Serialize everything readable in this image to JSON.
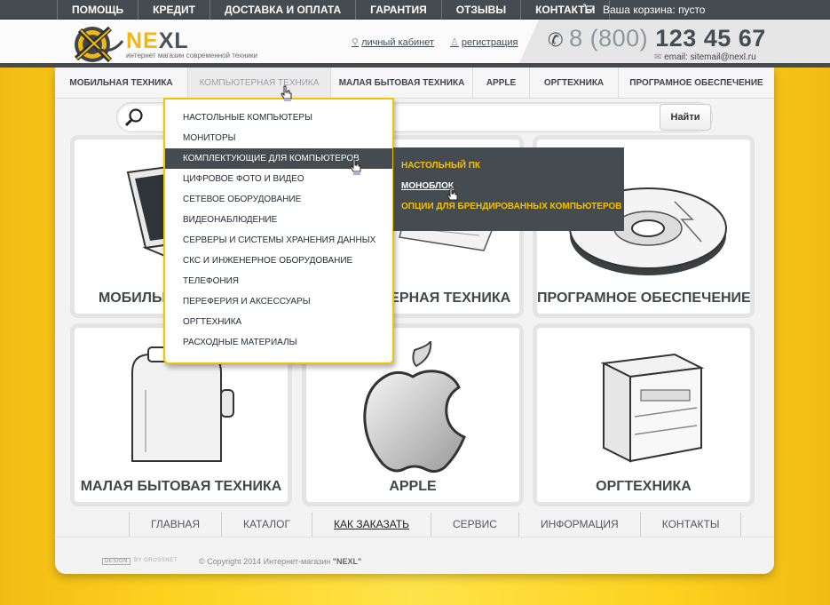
{
  "topbar": {
    "links": [
      "ПОМОЩЬ",
      "КРЕДИТ",
      "ДОСТАВКА И ОПЛАТА",
      "ГАРАНТИЯ",
      "ОТЗЫВЫ",
      "КОНТАКТЫ"
    ],
    "cart_text": "Ваша корзина: пусто",
    "cart_icon": "cart-icon"
  },
  "header": {
    "brand_ne": "NE",
    "brand_xl": "XL",
    "tagline": "интернет магазин современной техники",
    "account_link": "личный кабинет",
    "register_link": "регистрация",
    "phone_prefix": "8 (800)",
    "phone_number": "123 45 67",
    "email": "email: sitemail@nexl.ru"
  },
  "mainnav": {
    "items": [
      "МОБИЛЬНАЯ ТЕХНИКА",
      "КОМПЬЮТЕРНАЯ ТЕХНИКА",
      "МАЛАЯ БЫТОВАЯ ТЕХНИКА",
      "APPLE",
      "ОРГТЕХНИКА",
      "ПРОГРАМНОЕ ОБЕСПЕЧЕНИЕ"
    ],
    "active": "КОМПЬЮТЕРНАЯ ТЕХНИКА"
  },
  "search": {
    "placeholder": "",
    "button": "Найти"
  },
  "dropdown": {
    "items": [
      "НАСТОЛЬНЫЕ КОМПЬЮТЕРЫ",
      "МОНИТОРЫ",
      "КОМПЛЕКТУЮЩИЕ ДЛЯ КОМПЬЮТЕРОВ",
      "ЦИФРОВОЕ ФОТО И ВИДЕО",
      "СЕТЕВОЕ ОБОРУДОВАНИЕ",
      "ВИДЕОНАБЛЮДЕНИЕ",
      "СЕРВЕРЫ И СИСТЕМЫ ХРАНЕНИЯ ДАННЫХ",
      "СКС И ИНЖЕНЕРНОЕ ОБОРУДОВАНИЕ",
      "ТЕЛЕФОНИЯ",
      "ПЕРЕФЕРИЯ И АКСЕССУАРЫ",
      "ОРГТЕХНИКА",
      "РАСХОДНЫЕ МАТЕРИАЛЫ"
    ],
    "active": "КОМПЛЕКТУЮЩИЕ ДЛЯ КОМПЬЮТЕРОВ",
    "submenu": [
      "НАСТОЛЬНЫЙ ПК",
      "МОНОБЛОК",
      "ОПЦИИ ДЛЯ БРЕНДИРОВАННЫХ КОМПЬЮТЕРОВ"
    ],
    "submenu_hover": "МОНОБЛОК"
  },
  "tiles": [
    {
      "title": "МОБИЛЬНАЯ ТЕХНИКА",
      "icon": "laptop-icon"
    },
    {
      "title": "КОМПЬЮТЕРНАЯ ТЕХНИКА",
      "icon": "computer-icon"
    },
    {
      "title": "ПРОГРАМНОЕ ОБЕСПЕЧЕНИЕ",
      "icon": "disc-icon"
    },
    {
      "title": "МАЛАЯ БЫТОВАЯ ТЕХНИКА",
      "icon": "toaster-icon"
    },
    {
      "title": "APPLE",
      "icon": "apple-logo-icon"
    },
    {
      "title": "ОРГТЕХНИКА",
      "icon": "printer-icon"
    }
  ],
  "footer": {
    "links": [
      "ГЛАВНАЯ",
      "КАТАЛОГ",
      "КАК ЗАКАЗАТЬ",
      "СЕРВИС",
      "ИНФОРМАЦИЯ",
      "КОНТАКТЫ"
    ],
    "active": "КАК ЗАКАЗАТЬ",
    "design_badge": "DESIGN",
    "design_by": "BY GROSSNET",
    "copyright_prefix": "© Copyright 2014 Интернет-магазин",
    "copyright_brand": "\"NEXL\""
  },
  "colors": {
    "accent": "#f3c200",
    "dark": "#444c52",
    "background": "#fdd21f"
  }
}
